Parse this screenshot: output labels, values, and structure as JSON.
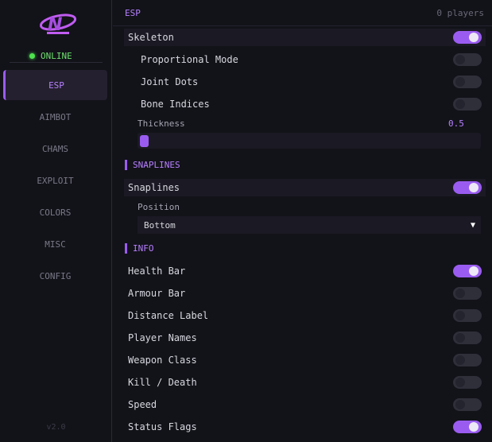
{
  "sidebar": {
    "status": "ONLINE",
    "items": [
      {
        "label": "ESP"
      },
      {
        "label": "AIMBOT"
      },
      {
        "label": "CHAMS"
      },
      {
        "label": "EXPLOIT"
      },
      {
        "label": "COLORS"
      },
      {
        "label": "MISC"
      },
      {
        "label": "CONFIG"
      }
    ],
    "active": "ESP",
    "version": "v2.0"
  },
  "header": {
    "title": "ESP",
    "player_count": "0 players"
  },
  "skeleton": {
    "label": "Skeleton",
    "enabled": true
  },
  "skeleton_options": [
    {
      "label": "Proportional Mode",
      "enabled": false
    },
    {
      "label": "Joint Dots",
      "enabled": false
    },
    {
      "label": "Bone Indices",
      "enabled": false
    }
  ],
  "thickness": {
    "label": "Thickness",
    "value": "0.5"
  },
  "sections": {
    "snaplines": "SNAPLINES",
    "info": "INFO"
  },
  "snaplines": {
    "label": "Snaplines",
    "enabled": true
  },
  "position": {
    "label": "Position",
    "value": "Bottom",
    "arrow": "▼"
  },
  "info_items": [
    {
      "label": "Health Bar",
      "enabled": true
    },
    {
      "label": "Armour Bar",
      "enabled": false
    },
    {
      "label": "Distance Label",
      "enabled": false
    },
    {
      "label": "Player Names",
      "enabled": false
    },
    {
      "label": "Weapon Class",
      "enabled": false
    },
    {
      "label": "Kill / Death",
      "enabled": false
    },
    {
      "label": "Speed",
      "enabled": false
    },
    {
      "label": "Status Flags",
      "enabled": true
    }
  ],
  "colors": {
    "accent": "#9a5cf0",
    "online": "#4ee34e",
    "background": "#121219"
  }
}
